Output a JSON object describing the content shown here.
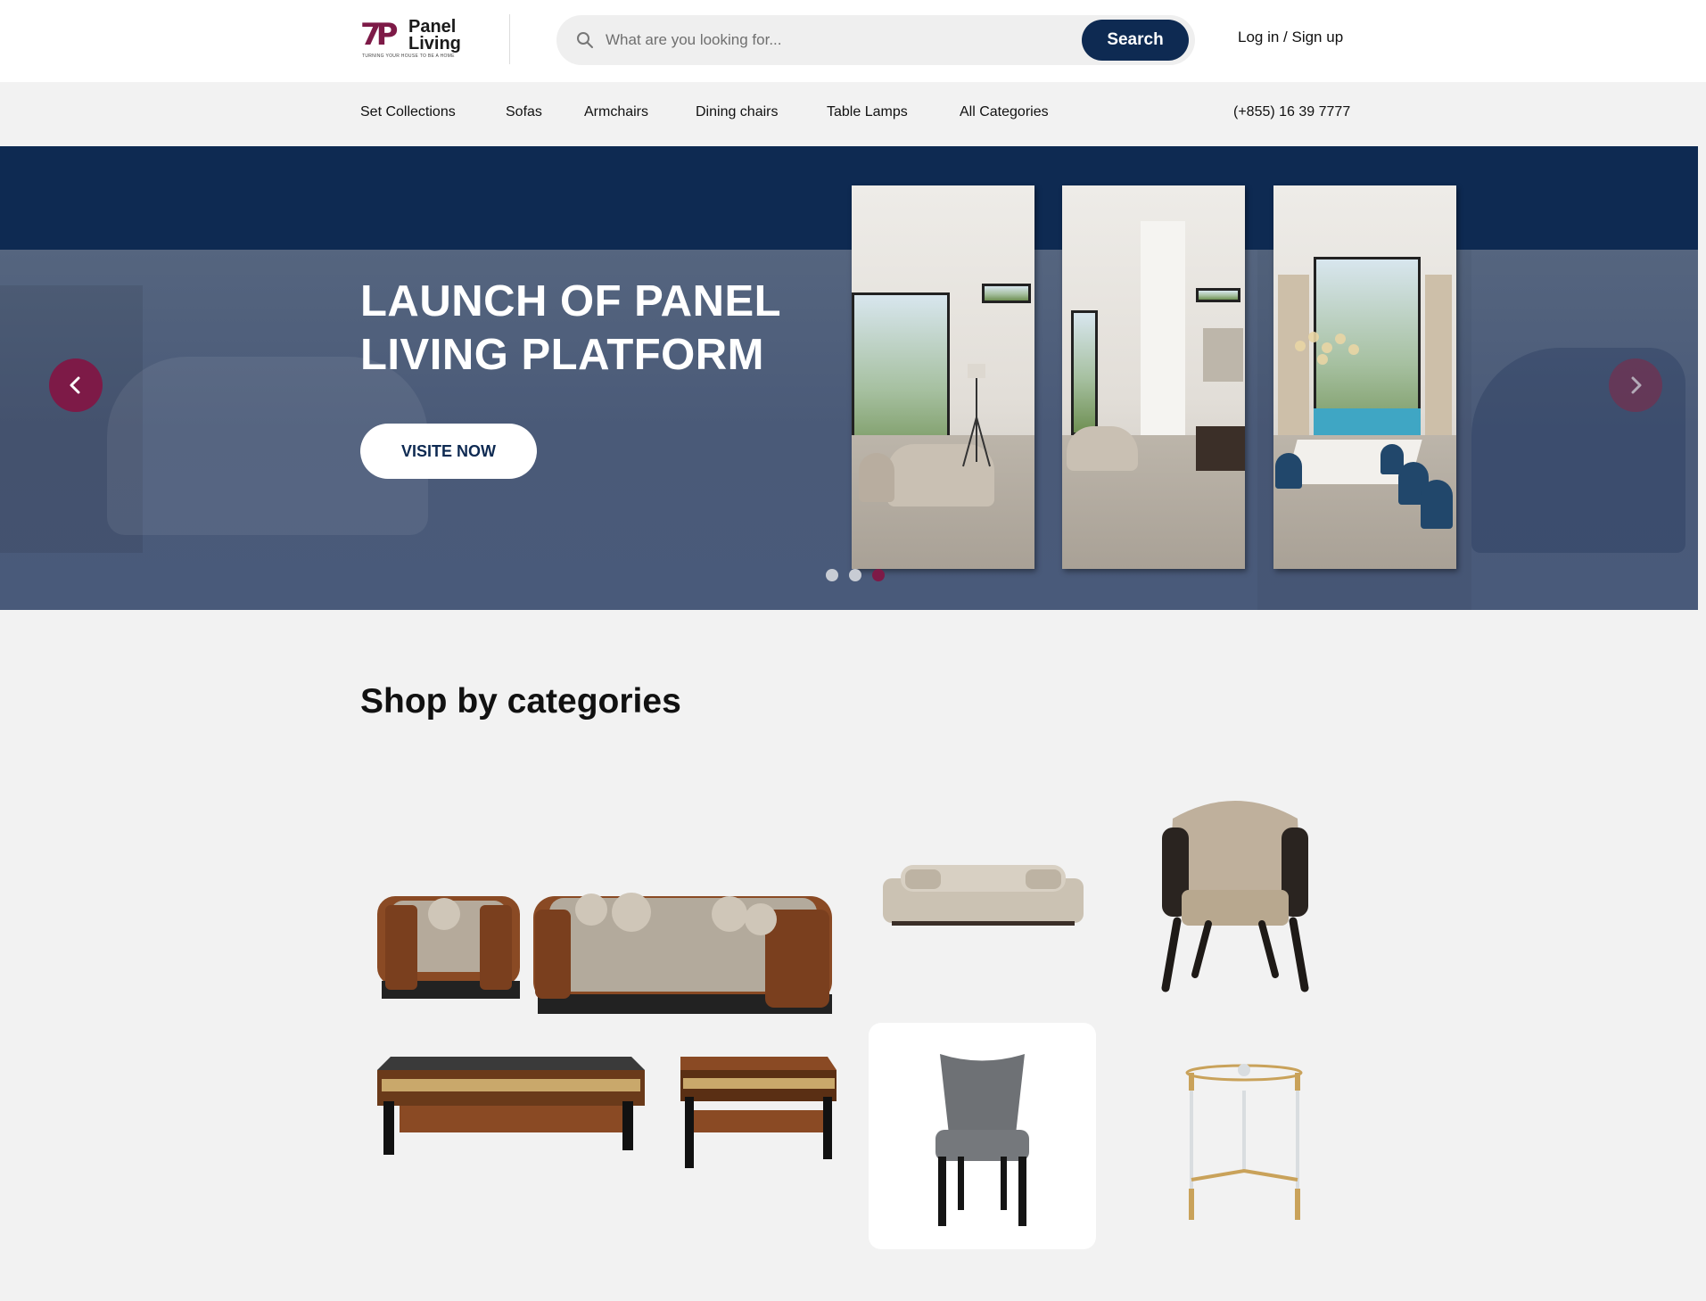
{
  "brand": {
    "logo_mark": "7P",
    "name_line1": "Panel",
    "name_line2": "Living",
    "tagline": "TURNING YOUR HOUSE TO BE A HOME"
  },
  "search": {
    "placeholder": "What are you looking for...",
    "button_label": "Search"
  },
  "auth": {
    "label": "Log in / Sign up"
  },
  "nav": {
    "items": [
      {
        "label": "Set Collections"
      },
      {
        "label": "Sofas"
      },
      {
        "label": "Armchairs"
      },
      {
        "label": "Dining chairs"
      },
      {
        "label": "Table Lamps"
      },
      {
        "label": "All Categories"
      }
    ],
    "phone": "(+855) 16 39 7777"
  },
  "hero": {
    "title": "LAUNCH OF PANEL LIVING PLATFORM",
    "cta_label": "VISITE NOW",
    "slides_count": 3,
    "active_slide": 3
  },
  "categories": {
    "title": "Shop by categories",
    "items": [
      {
        "name": "set-collection"
      },
      {
        "name": "sofa"
      },
      {
        "name": "armchair"
      },
      {
        "name": "dining-chair"
      },
      {
        "name": "side-table"
      }
    ]
  },
  "colors": {
    "brand_navy": "#0e2a52",
    "brand_burgundy": "#7d1a47",
    "page_bg": "#f2f2f2"
  }
}
